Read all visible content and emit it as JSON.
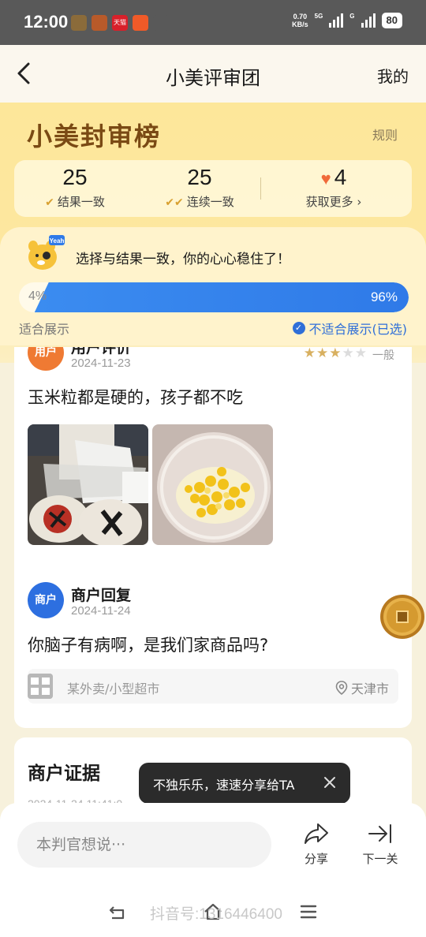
{
  "status_bar": {
    "time": "12:00",
    "net_speed_value": "0.70",
    "net_speed_unit": "KB/s",
    "sim1_label": "5G",
    "sim2_label": "G",
    "battery": "80",
    "app_icons": [
      {
        "name": "game-icon-1",
        "color": "#8b6b3a",
        "text": ""
      },
      {
        "name": "game-icon-2",
        "color": "#b85a2a",
        "text": ""
      },
      {
        "name": "tmall-icon",
        "color": "#d8202a",
        "text": "天猫"
      },
      {
        "name": "app-icon-4",
        "color": "#f05a28",
        "text": ""
      },
      {
        "name": "sim-card-icon",
        "color": "#595959",
        "text": ""
      }
    ]
  },
  "nav": {
    "title": "小美评审团",
    "mine": "我的"
  },
  "hero": {
    "title": "小美封审榜",
    "rules": "规则",
    "stats": [
      {
        "value": "25",
        "label": "结果一致",
        "icon": "check-icon"
      },
      {
        "value": "25",
        "label": "连续一致",
        "icon": "double-check-icon"
      },
      {
        "value": "4",
        "label": "获取更多",
        "icon": "heart-icon",
        "suffix": "›"
      }
    ]
  },
  "verdict": {
    "message": "选择与结果一致，你的心心稳住了！",
    "mascot_text": "Yeah",
    "left_percent": "4%",
    "right_percent": "96%",
    "right_fraction": 0.96,
    "left_option": "适合展示",
    "right_option": "不适合展示(已选)",
    "accent": "#2f7ae8"
  },
  "review": {
    "user_badge": "用户",
    "user_title": "用户评价",
    "date": "2024-11-23",
    "rating": 3,
    "rating_max": 5,
    "rating_text": "一般",
    "text": "玉米粒都是硬的，孩子都不吃",
    "photos": [
      "corn-bag-photo",
      "corn-cup-photo"
    ],
    "reply_badge": "商户",
    "reply_title": "商户回复",
    "reply_date": "2024-11-24",
    "reply_text": "你脑子有病啊，是我们家商品吗?",
    "shop_name": "某外卖/小型超市",
    "shop_city": "天津市"
  },
  "evidence": {
    "title": "商户证据",
    "date_partial": "2024-11-24 11:41:0"
  },
  "tooltip": {
    "text": "不独乐乐，速速分享给TA"
  },
  "bottom": {
    "comment_placeholder": "本判官想说···",
    "share_label": "分享",
    "next_label": "下一关"
  },
  "watermark": "抖音号:1316446400"
}
